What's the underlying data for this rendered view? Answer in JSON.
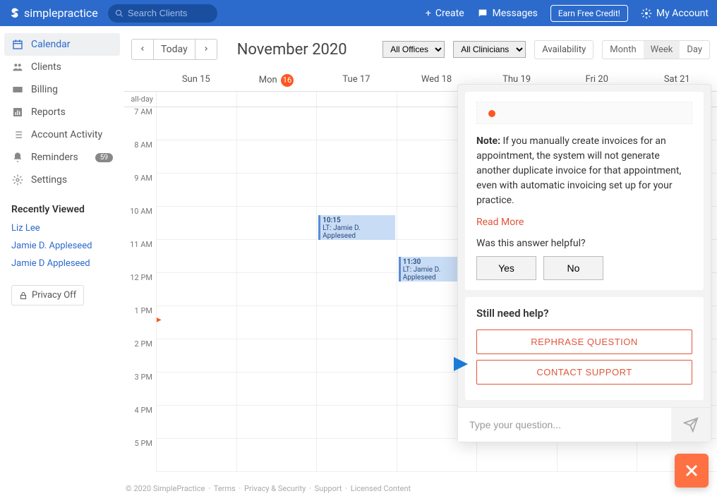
{
  "header": {
    "logo": "simplepractice",
    "search_placeholder": "Search Clients",
    "create": "Create",
    "messages": "Messages",
    "credit": "Earn Free Credit!",
    "account": "My Account"
  },
  "sidebar": {
    "items": [
      {
        "label": "Calendar"
      },
      {
        "label": "Clients"
      },
      {
        "label": "Billing"
      },
      {
        "label": "Reports"
      },
      {
        "label": "Account Activity"
      },
      {
        "label": "Reminders",
        "badge": "59"
      },
      {
        "label": "Settings"
      }
    ],
    "recently_title": "Recently Viewed",
    "recent": [
      "Liz Lee",
      "Jamie D. Appleseed",
      "Jamie D Appleseed"
    ],
    "privacy": "Privacy Off"
  },
  "calendar": {
    "today": "Today",
    "title": "November 2020",
    "select_office": "All Offices",
    "select_clinician": "All Clinicians",
    "availability": "Availability",
    "views": [
      "Month",
      "Week",
      "Day"
    ],
    "days": [
      "Sun 15",
      "Mon",
      "Tue 17",
      "Wed 18",
      "Thu 19",
      "Fri 20",
      "Sat 21"
    ],
    "today_date": "16",
    "allday": "all-day",
    "hours": [
      "7 AM",
      "8 AM",
      "9 AM",
      "10 AM",
      "11 AM",
      "12 PM",
      "1 PM",
      "2 PM",
      "3 PM",
      "4 PM",
      "5 PM"
    ],
    "events": [
      {
        "time": "10:15",
        "title": "LT: Jamie D. Appleseed"
      },
      {
        "time": "11:30",
        "title": "LT: Jamie D. Appleseed"
      }
    ]
  },
  "help": {
    "note_label": "Note:",
    "note_text": " If you manually create invoices for an appointment, the system will not generate another duplicate invoice for that appointment, even with automatic invoicing set up for your practice.",
    "read_more": "Read More",
    "helpful_q": "Was this answer helpful?",
    "yes": "Yes",
    "no": "No",
    "still_need": "Still need help?",
    "rephrase": "REPHRASE QUESTION",
    "contact": "CONTACT SUPPORT",
    "input_placeholder": "Type your question..."
  },
  "footer": {
    "copyright": "© 2020 SimplePractice",
    "links": [
      "Terms",
      "Privacy & Security",
      "Support",
      "Licensed Content"
    ]
  }
}
